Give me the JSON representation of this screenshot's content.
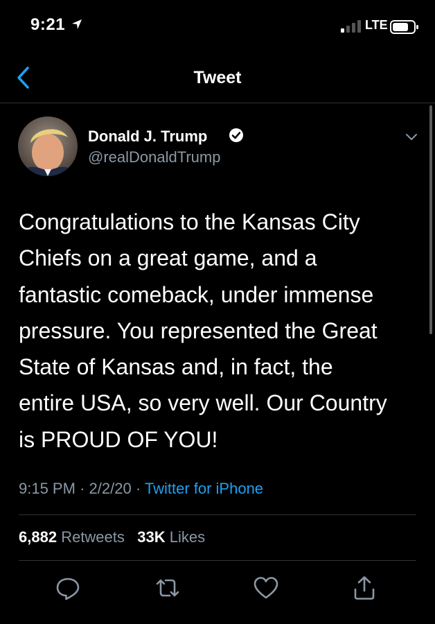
{
  "status_bar": {
    "time": "9:21",
    "network": "LTE"
  },
  "nav": {
    "title": "Tweet"
  },
  "tweet": {
    "author_name": "Donald J. Trump",
    "handle": "@realDonaldTrump",
    "text_lines": [
      "Congratulations to the Kansas City",
      "Chiefs on a great game, and a",
      "fantastic comeback, under immense",
      "pressure. You represented the Great",
      "State of Kansas and, in fact, the",
      "entire USA, so very well. Our Country",
      "is PROUD OF YOU!"
    ],
    "time": "9:15 PM",
    "date": "2/2/20",
    "source": "Twitter for iPhone",
    "retweet_count": "6,882",
    "retweet_label": "Retweets",
    "like_count": "33K",
    "like_label": "Likes"
  },
  "actions": [
    "reply-icon",
    "retweet-icon",
    "like-icon",
    "share-icon"
  ],
  "colors": {
    "background": "#000000",
    "secondary_text": "#8b98a5",
    "link": "#1da1f2",
    "accent_back": "#1da1f2",
    "divider": "#2f3336"
  }
}
